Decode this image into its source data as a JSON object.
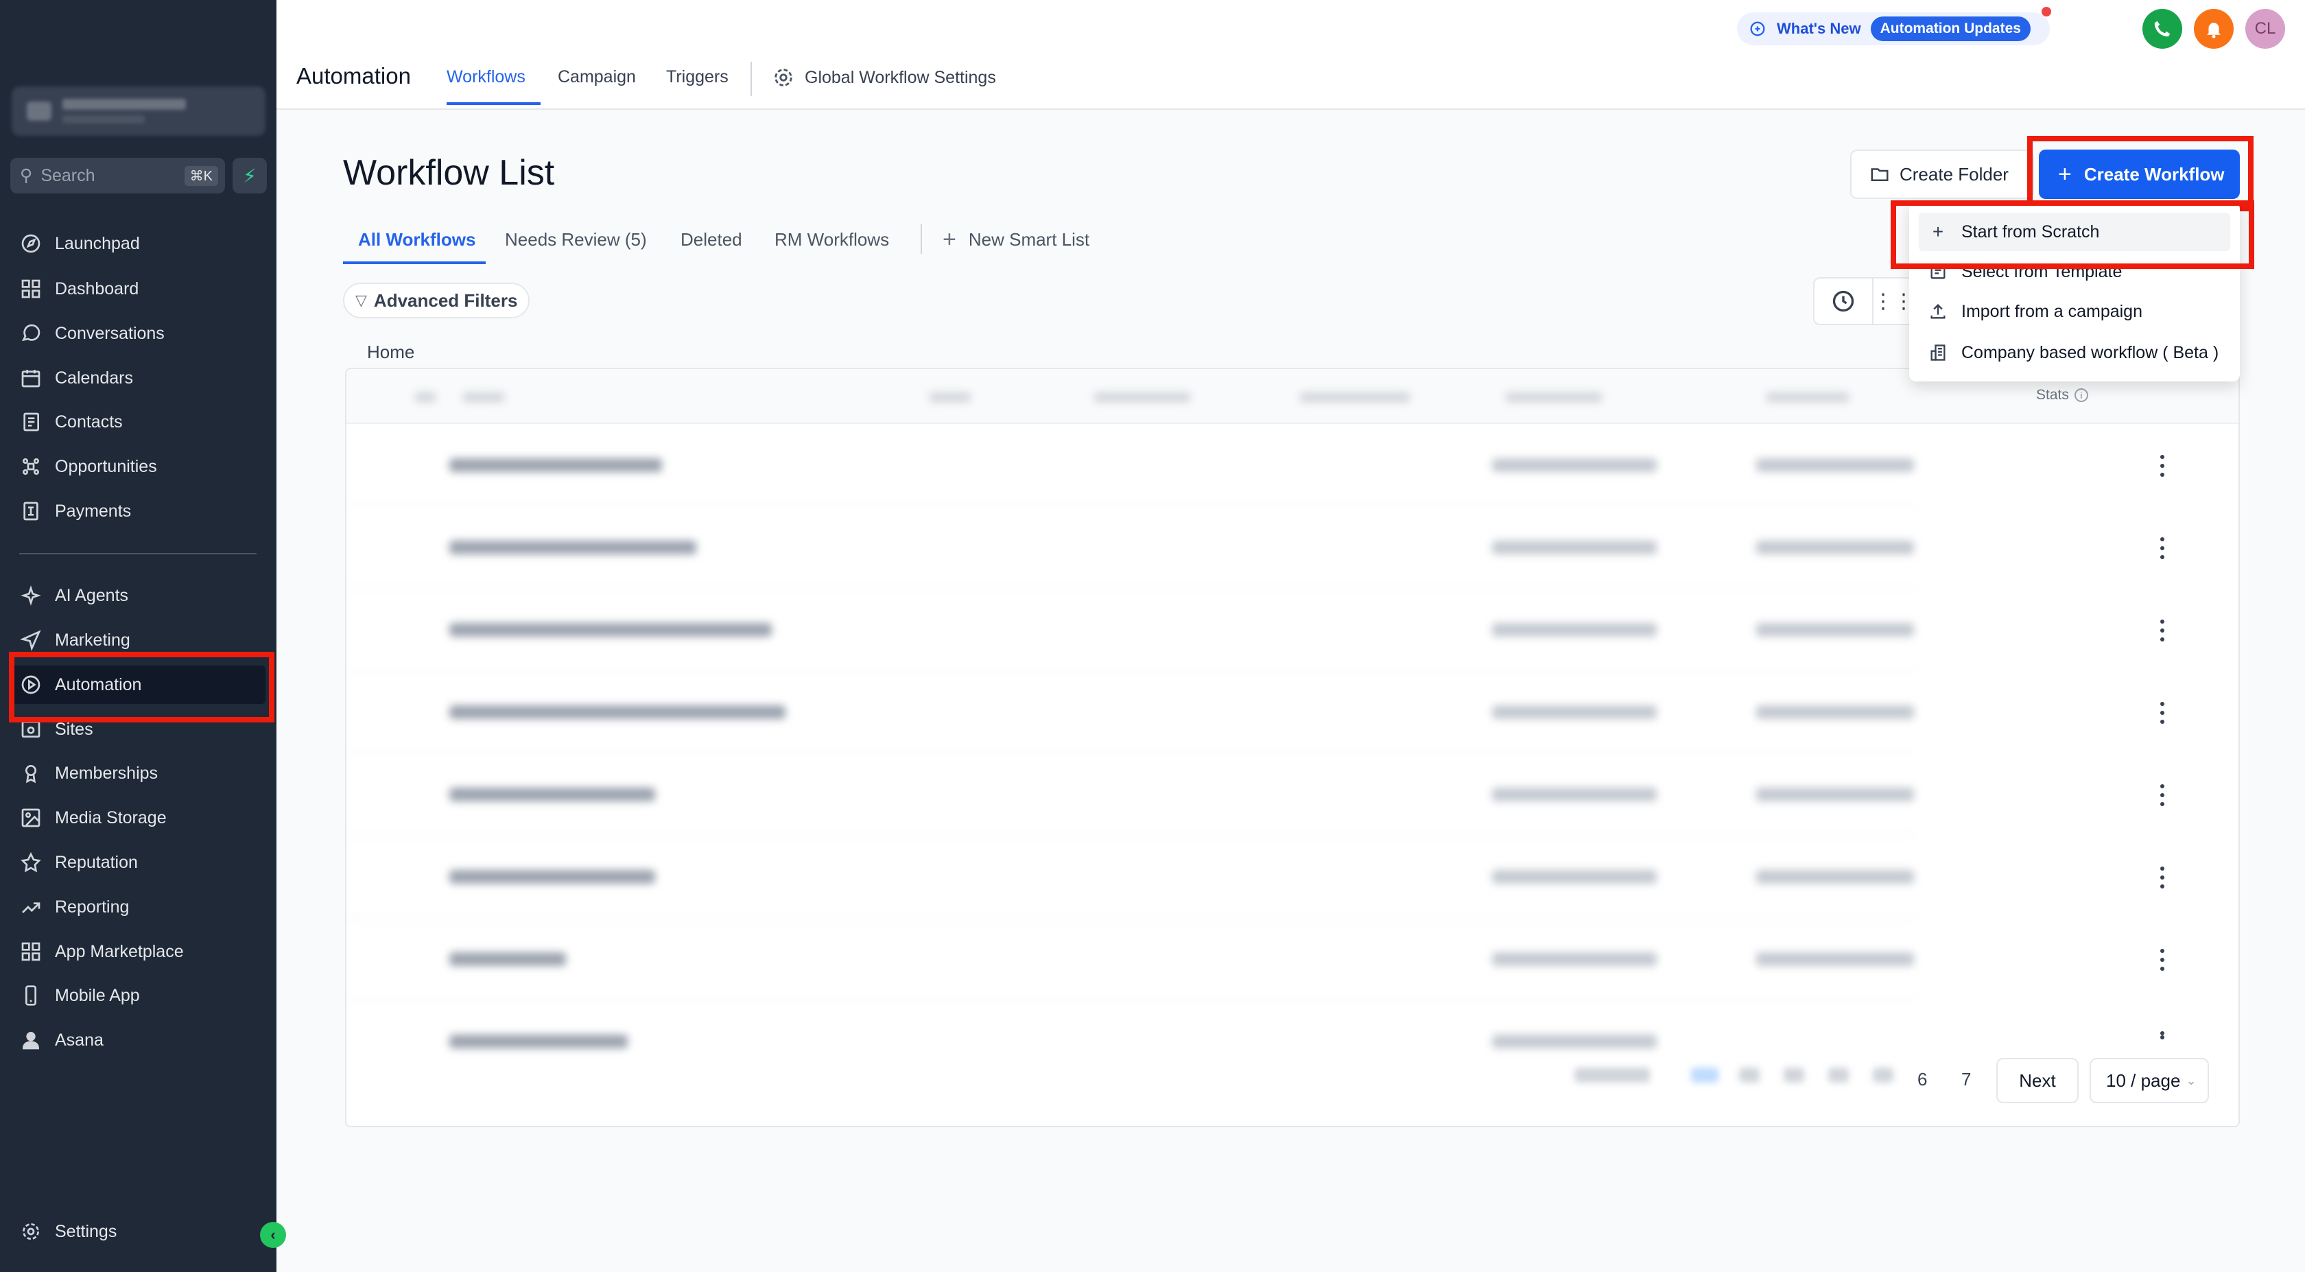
{
  "sidebar": {
    "search_placeholder": "Search",
    "search_shortcut": "⌘K",
    "items": [
      {
        "label": "Launchpad",
        "icon": "rocket-icon"
      },
      {
        "label": "Dashboard",
        "icon": "grid-icon"
      },
      {
        "label": "Conversations",
        "icon": "chat-icon"
      },
      {
        "label": "Calendars",
        "icon": "calendar-icon"
      },
      {
        "label": "Contacts",
        "icon": "contacts-icon"
      },
      {
        "label": "Opportunities",
        "icon": "opportunities-icon"
      },
      {
        "label": "Payments",
        "icon": "payments-icon"
      },
      {
        "label": "AI Agents",
        "icon": "sparkle-icon"
      },
      {
        "label": "Marketing",
        "icon": "send-icon"
      },
      {
        "label": "Automation",
        "icon": "automation-icon"
      },
      {
        "label": "Sites",
        "icon": "sites-icon"
      },
      {
        "label": "Memberships",
        "icon": "memberships-icon"
      },
      {
        "label": "Media Storage",
        "icon": "image-icon"
      },
      {
        "label": "Reputation",
        "icon": "star-icon"
      },
      {
        "label": "Reporting",
        "icon": "chart-line-icon"
      },
      {
        "label": "App Marketplace",
        "icon": "grid-icon"
      },
      {
        "label": "Mobile App",
        "icon": "phone-icon"
      },
      {
        "label": "Asana",
        "icon": "user-icon"
      }
    ],
    "settings_label": "Settings"
  },
  "topbar": {
    "module_title": "Automation",
    "tabs": [
      "Workflows",
      "Campaign",
      "Triggers"
    ],
    "global_settings": "Global Workflow Settings",
    "whats_new": "What's New",
    "automation_updates": "Automation Updates",
    "avatar_initials": "CL"
  },
  "main": {
    "title": "Workflow List",
    "sub_tabs": [
      "All Workflows",
      "Needs Review (5)",
      "Deleted",
      "RM Workflows"
    ],
    "new_smart_list": "New Smart List",
    "advanced_filters": "Advanced Filters",
    "breadcrumb": "Home",
    "create_folder": "Create Folder",
    "create_workflow": "Create Workflow",
    "stats_header": "Stats"
  },
  "dropdown": {
    "items": [
      "Start from Scratch",
      "Select from Template",
      "Import from a campaign",
      "Company based workflow ( Beta )"
    ]
  },
  "pagination": {
    "pages": [
      "6",
      "7"
    ],
    "next": "Next",
    "per_page": "10 / page"
  },
  "colors": {
    "primary": "#155eef",
    "sidebar_bg": "#1f2937",
    "highlight": "#ee1c0c",
    "phone_green": "#16a34a",
    "bell_orange": "#f97316",
    "avatar_pink": "#d8a0c8"
  }
}
